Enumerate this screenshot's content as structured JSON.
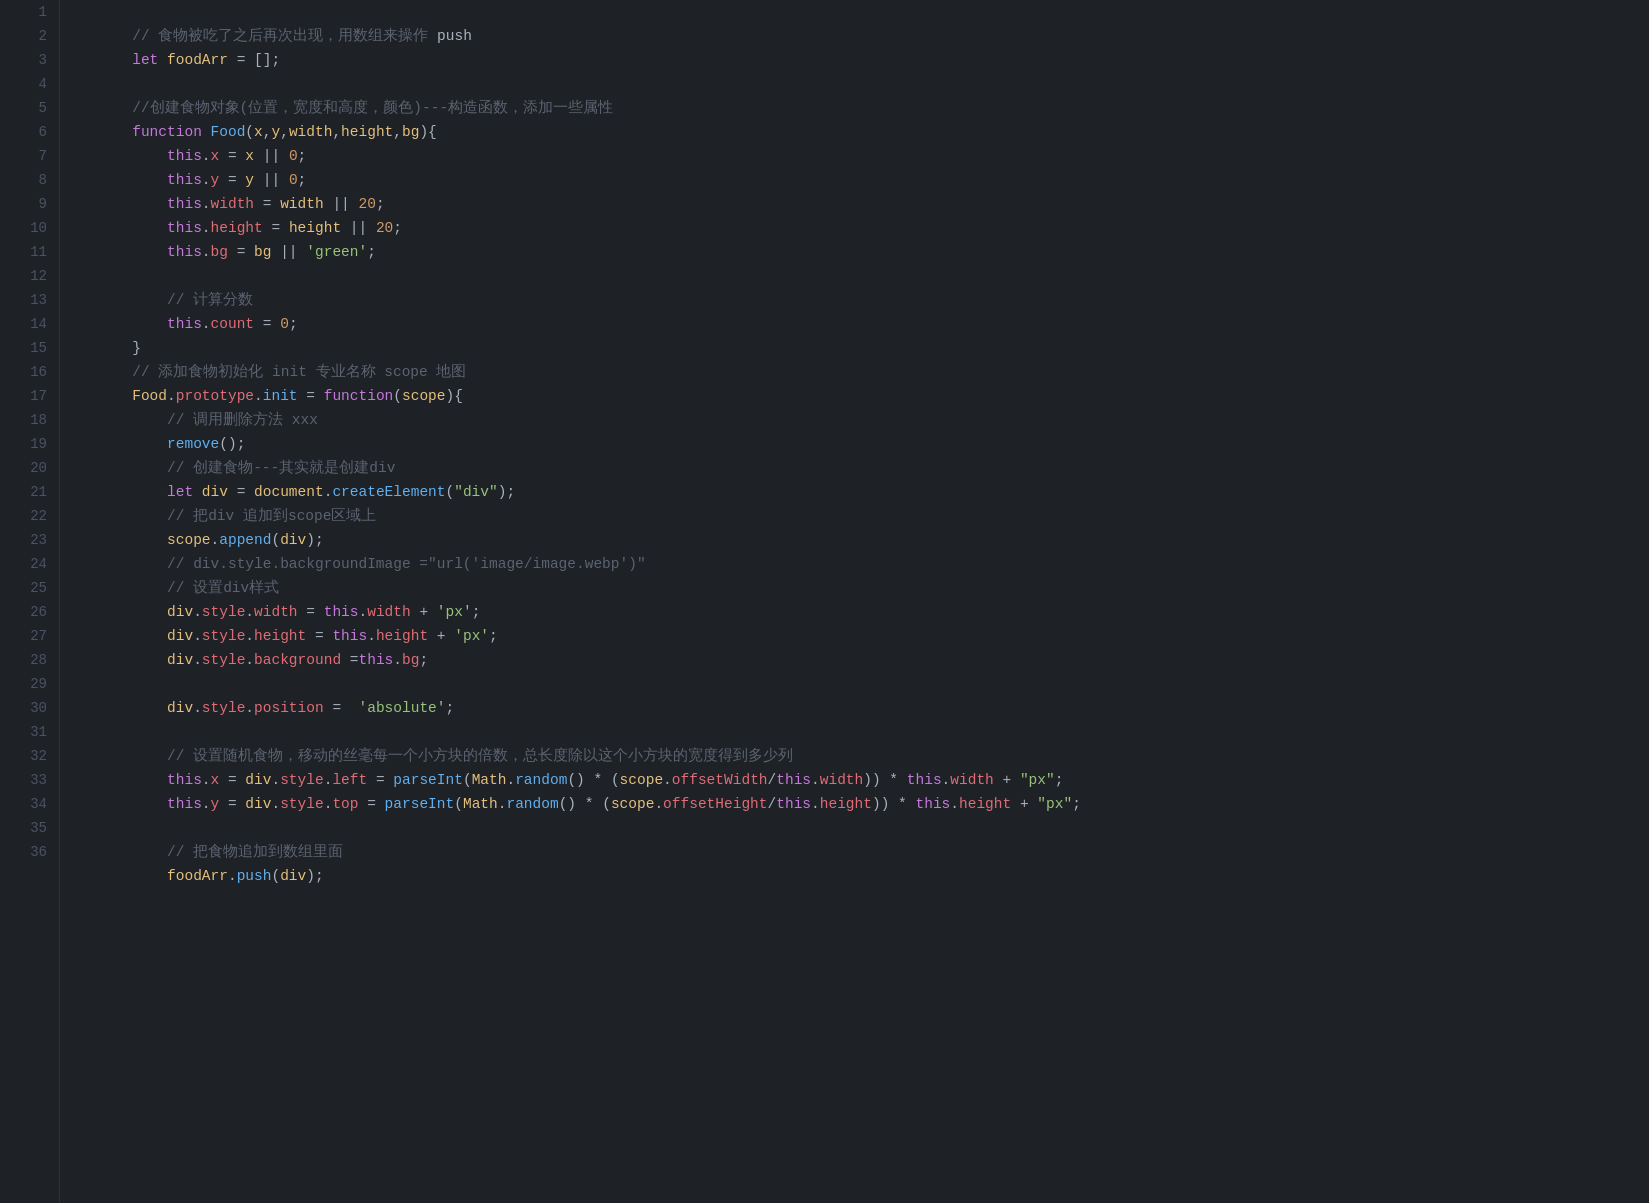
{
  "editor": {
    "background": "#1e2227",
    "lines": [
      {
        "num": 1,
        "content": "// 食物被吃了之后再次出现，用数组来操作 push"
      },
      {
        "num": 2,
        "content": "let foodArr = [];"
      },
      {
        "num": 3,
        "content": ""
      },
      {
        "num": 4,
        "content": "//创建食物对象(位置，宽度和高度，颜色)---构造函数，添加一些属性"
      },
      {
        "num": 5,
        "content": "function Food(x,y,width,height,bg){"
      },
      {
        "num": 6,
        "content": "    this.x = x || 0;"
      },
      {
        "num": 7,
        "content": "    this.y = y || 0;"
      },
      {
        "num": 8,
        "content": "    this.width = width || 20;"
      },
      {
        "num": 9,
        "content": "    this.height = height || 20;"
      },
      {
        "num": 10,
        "content": "    this.bg = bg || 'green';"
      },
      {
        "num": 11,
        "content": ""
      },
      {
        "num": 12,
        "content": "    // 计算分数"
      },
      {
        "num": 13,
        "content": "    this.count = 0;"
      },
      {
        "num": 14,
        "content": "}"
      },
      {
        "num": 15,
        "content": "// 添加食物初始化 init 专业名称 scope 地图"
      },
      {
        "num": 16,
        "content": "Food.prototype.init = function(scope){"
      },
      {
        "num": 17,
        "content": "    // 调用删除方法 xxx"
      },
      {
        "num": 18,
        "content": "    remove();"
      },
      {
        "num": 19,
        "content": "    // 创建食物---其实就是创建div"
      },
      {
        "num": 20,
        "content": "    let div = document.createElement(\"div\");"
      },
      {
        "num": 21,
        "content": "    // 把div 追加到scope区域上"
      },
      {
        "num": 22,
        "content": "    scope.append(div);"
      },
      {
        "num": 23,
        "content": "    // div.style.backgroundImage =\"url('image/image.webp')\""
      },
      {
        "num": 24,
        "content": "    // 设置div样式"
      },
      {
        "num": 25,
        "content": "    div.style.width = this.width + 'px';"
      },
      {
        "num": 26,
        "content": "    div.style.height = this.height + 'px';"
      },
      {
        "num": 27,
        "content": "    div.style.background =this.bg;"
      },
      {
        "num": 28,
        "content": ""
      },
      {
        "num": 29,
        "content": "    div.style.position =  'absolute';"
      },
      {
        "num": 30,
        "content": ""
      },
      {
        "num": 31,
        "content": "    // 设置随机食物，移动的丝毫每一个小方块的倍数，总长度除以这个小方块的宽度得到多少列"
      },
      {
        "num": 32,
        "content": "    this.x = div.style.left = parseInt(Math.random() * (scope.offsetWidth/this.width)) * this.width + \"px\";"
      },
      {
        "num": 33,
        "content": "    this.y = div.style.top = parseInt(Math.random() * (scope.offsetHeight/this.height)) * this.height + \"px\";"
      },
      {
        "num": 34,
        "content": ""
      },
      {
        "num": 35,
        "content": "    // 把食物追加到数组里面"
      },
      {
        "num": 36,
        "content": "    foodArr.push(div);"
      }
    ]
  }
}
